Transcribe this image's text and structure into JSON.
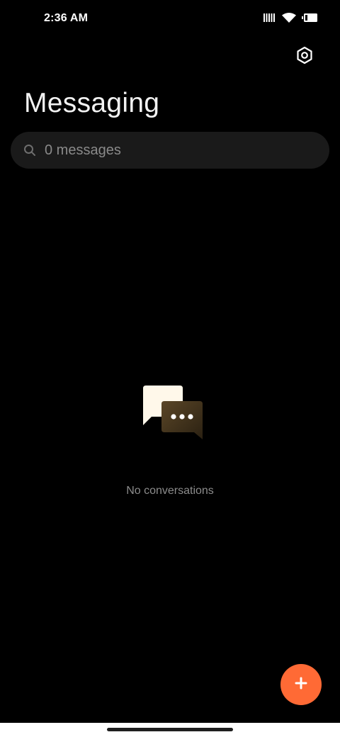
{
  "status_bar": {
    "time": "2:36 AM",
    "icons": [
      "signal-icon",
      "wifi-icon",
      "battery-icon"
    ]
  },
  "header": {
    "title": "Messaging",
    "settings_icon": "settings-hexagon-icon"
  },
  "search": {
    "placeholder": "0 messages",
    "icon": "search-icon"
  },
  "empty_state": {
    "icon": "chat-bubbles-icon",
    "text": "No conversations"
  },
  "fab": {
    "icon": "plus-icon",
    "color": "#ff6a35"
  },
  "colors": {
    "background": "#000000",
    "accent": "#ff6a35",
    "search_bg": "#1a1a1a",
    "secondary_text": "#8c8c8c"
  }
}
